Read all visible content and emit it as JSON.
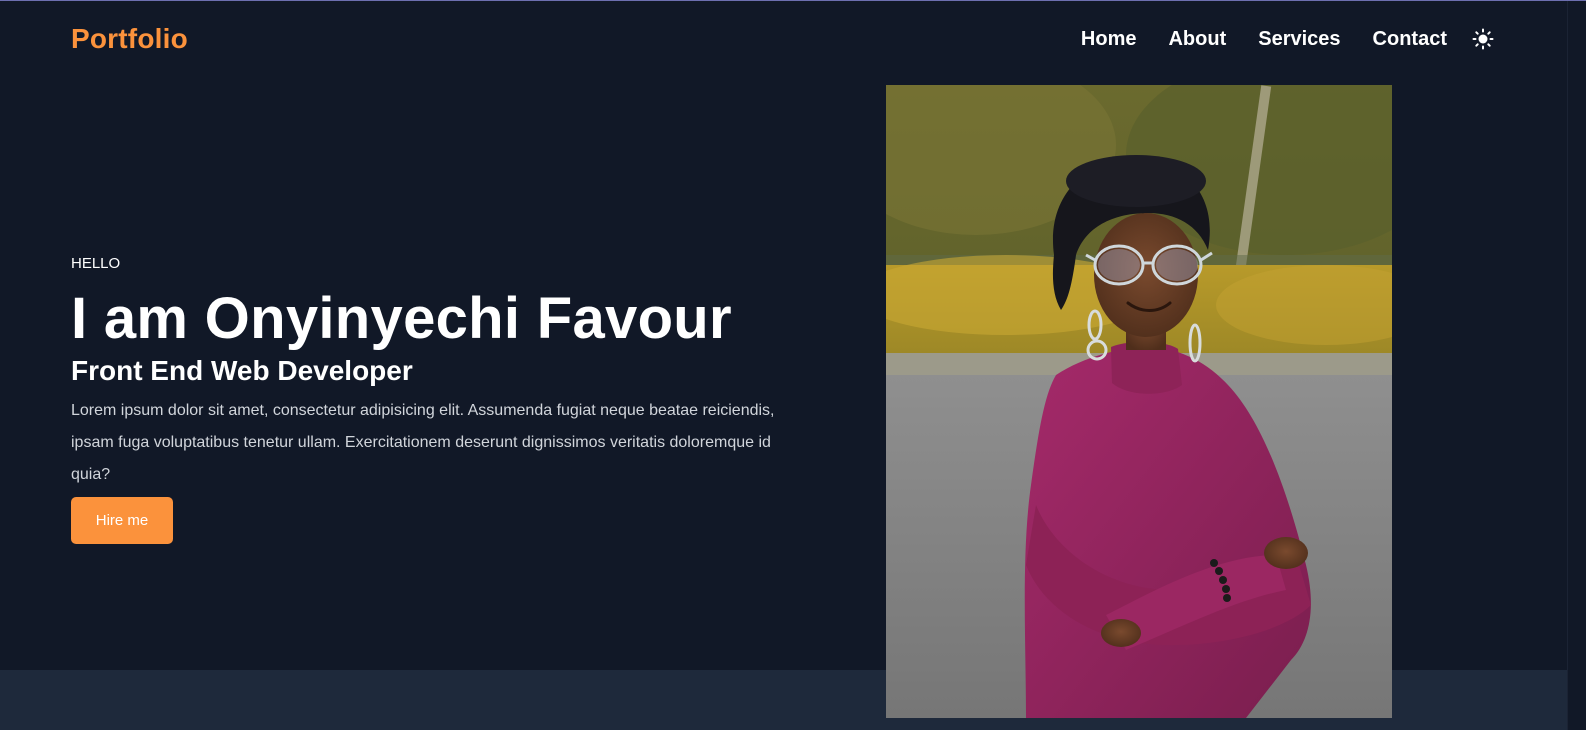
{
  "brand": {
    "logo": "Portfolio",
    "accent_color": "#fb923c",
    "background_color": "#111827",
    "band_color": "#1e293b"
  },
  "nav": {
    "items": [
      {
        "label": "Home"
      },
      {
        "label": "About"
      },
      {
        "label": "Services"
      },
      {
        "label": "Contact"
      }
    ],
    "theme_toggle_icon": "sun-icon"
  },
  "hero": {
    "greeting": "HELLO",
    "title": "I am Onyinyechi Favour",
    "subtitle": "Front End Web Developer",
    "description": "Lorem ipsum dolor sit amet, consectetur adipisicing elit. Assumenda fugiat neque beatae reiciendis, ipsam fuga voluptatibus tenetur ullam. Exercitationem deserunt dignissimos veritatis doloremque id quia?",
    "cta_label": "Hire me"
  }
}
